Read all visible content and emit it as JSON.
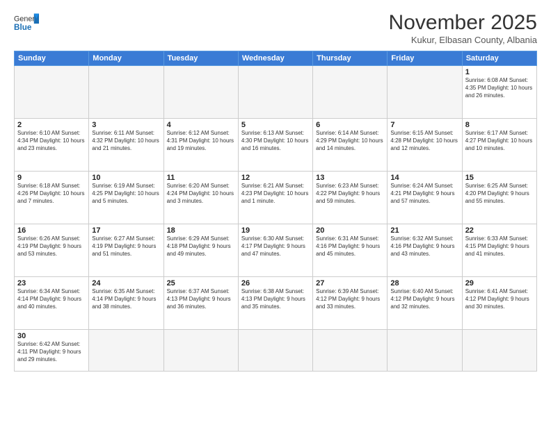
{
  "logo": {
    "text_general": "General",
    "text_blue": "Blue"
  },
  "title": "November 2025",
  "location": "Kukur, Elbasan County, Albania",
  "weekdays": [
    "Sunday",
    "Monday",
    "Tuesday",
    "Wednesday",
    "Thursday",
    "Friday",
    "Saturday"
  ],
  "weeks": [
    [
      {
        "day": "",
        "empty": true
      },
      {
        "day": "",
        "empty": true
      },
      {
        "day": "",
        "empty": true
      },
      {
        "day": "",
        "empty": true
      },
      {
        "day": "",
        "empty": true
      },
      {
        "day": "",
        "empty": true
      },
      {
        "day": "1",
        "info": "Sunrise: 6:08 AM\nSunset: 4:35 PM\nDaylight: 10 hours\nand 26 minutes."
      }
    ],
    [
      {
        "day": "2",
        "info": "Sunrise: 6:10 AM\nSunset: 4:34 PM\nDaylight: 10 hours\nand 23 minutes."
      },
      {
        "day": "3",
        "info": "Sunrise: 6:11 AM\nSunset: 4:32 PM\nDaylight: 10 hours\nand 21 minutes."
      },
      {
        "day": "4",
        "info": "Sunrise: 6:12 AM\nSunset: 4:31 PM\nDaylight: 10 hours\nand 19 minutes."
      },
      {
        "day": "5",
        "info": "Sunrise: 6:13 AM\nSunset: 4:30 PM\nDaylight: 10 hours\nand 16 minutes."
      },
      {
        "day": "6",
        "info": "Sunrise: 6:14 AM\nSunset: 4:29 PM\nDaylight: 10 hours\nand 14 minutes."
      },
      {
        "day": "7",
        "info": "Sunrise: 6:15 AM\nSunset: 4:28 PM\nDaylight: 10 hours\nand 12 minutes."
      },
      {
        "day": "8",
        "info": "Sunrise: 6:17 AM\nSunset: 4:27 PM\nDaylight: 10 hours\nand 10 minutes."
      }
    ],
    [
      {
        "day": "9",
        "info": "Sunrise: 6:18 AM\nSunset: 4:26 PM\nDaylight: 10 hours\nand 7 minutes."
      },
      {
        "day": "10",
        "info": "Sunrise: 6:19 AM\nSunset: 4:25 PM\nDaylight: 10 hours\nand 5 minutes."
      },
      {
        "day": "11",
        "info": "Sunrise: 6:20 AM\nSunset: 4:24 PM\nDaylight: 10 hours\nand 3 minutes."
      },
      {
        "day": "12",
        "info": "Sunrise: 6:21 AM\nSunset: 4:23 PM\nDaylight: 10 hours\nand 1 minute."
      },
      {
        "day": "13",
        "info": "Sunrise: 6:23 AM\nSunset: 4:22 PM\nDaylight: 9 hours\nand 59 minutes."
      },
      {
        "day": "14",
        "info": "Sunrise: 6:24 AM\nSunset: 4:21 PM\nDaylight: 9 hours\nand 57 minutes."
      },
      {
        "day": "15",
        "info": "Sunrise: 6:25 AM\nSunset: 4:20 PM\nDaylight: 9 hours\nand 55 minutes."
      }
    ],
    [
      {
        "day": "16",
        "info": "Sunrise: 6:26 AM\nSunset: 4:19 PM\nDaylight: 9 hours\nand 53 minutes."
      },
      {
        "day": "17",
        "info": "Sunrise: 6:27 AM\nSunset: 4:19 PM\nDaylight: 9 hours\nand 51 minutes."
      },
      {
        "day": "18",
        "info": "Sunrise: 6:29 AM\nSunset: 4:18 PM\nDaylight: 9 hours\nand 49 minutes."
      },
      {
        "day": "19",
        "info": "Sunrise: 6:30 AM\nSunset: 4:17 PM\nDaylight: 9 hours\nand 47 minutes."
      },
      {
        "day": "20",
        "info": "Sunrise: 6:31 AM\nSunset: 4:16 PM\nDaylight: 9 hours\nand 45 minutes."
      },
      {
        "day": "21",
        "info": "Sunrise: 6:32 AM\nSunset: 4:16 PM\nDaylight: 9 hours\nand 43 minutes."
      },
      {
        "day": "22",
        "info": "Sunrise: 6:33 AM\nSunset: 4:15 PM\nDaylight: 9 hours\nand 41 minutes."
      }
    ],
    [
      {
        "day": "23",
        "info": "Sunrise: 6:34 AM\nSunset: 4:14 PM\nDaylight: 9 hours\nand 40 minutes."
      },
      {
        "day": "24",
        "info": "Sunrise: 6:35 AM\nSunset: 4:14 PM\nDaylight: 9 hours\nand 38 minutes."
      },
      {
        "day": "25",
        "info": "Sunrise: 6:37 AM\nSunset: 4:13 PM\nDaylight: 9 hours\nand 36 minutes."
      },
      {
        "day": "26",
        "info": "Sunrise: 6:38 AM\nSunset: 4:13 PM\nDaylight: 9 hours\nand 35 minutes."
      },
      {
        "day": "27",
        "info": "Sunrise: 6:39 AM\nSunset: 4:12 PM\nDaylight: 9 hours\nand 33 minutes."
      },
      {
        "day": "28",
        "info": "Sunrise: 6:40 AM\nSunset: 4:12 PM\nDaylight: 9 hours\nand 32 minutes."
      },
      {
        "day": "29",
        "info": "Sunrise: 6:41 AM\nSunset: 4:12 PM\nDaylight: 9 hours\nand 30 minutes."
      }
    ],
    [
      {
        "day": "30",
        "info": "Sunrise: 6:42 AM\nSunset: 4:11 PM\nDaylight: 9 hours\nand 29 minutes.",
        "last": true
      },
      {
        "day": "",
        "empty": true,
        "last": true
      },
      {
        "day": "",
        "empty": true,
        "last": true
      },
      {
        "day": "",
        "empty": true,
        "last": true
      },
      {
        "day": "",
        "empty": true,
        "last": true
      },
      {
        "day": "",
        "empty": true,
        "last": true
      },
      {
        "day": "",
        "empty": true,
        "last": true
      }
    ]
  ]
}
